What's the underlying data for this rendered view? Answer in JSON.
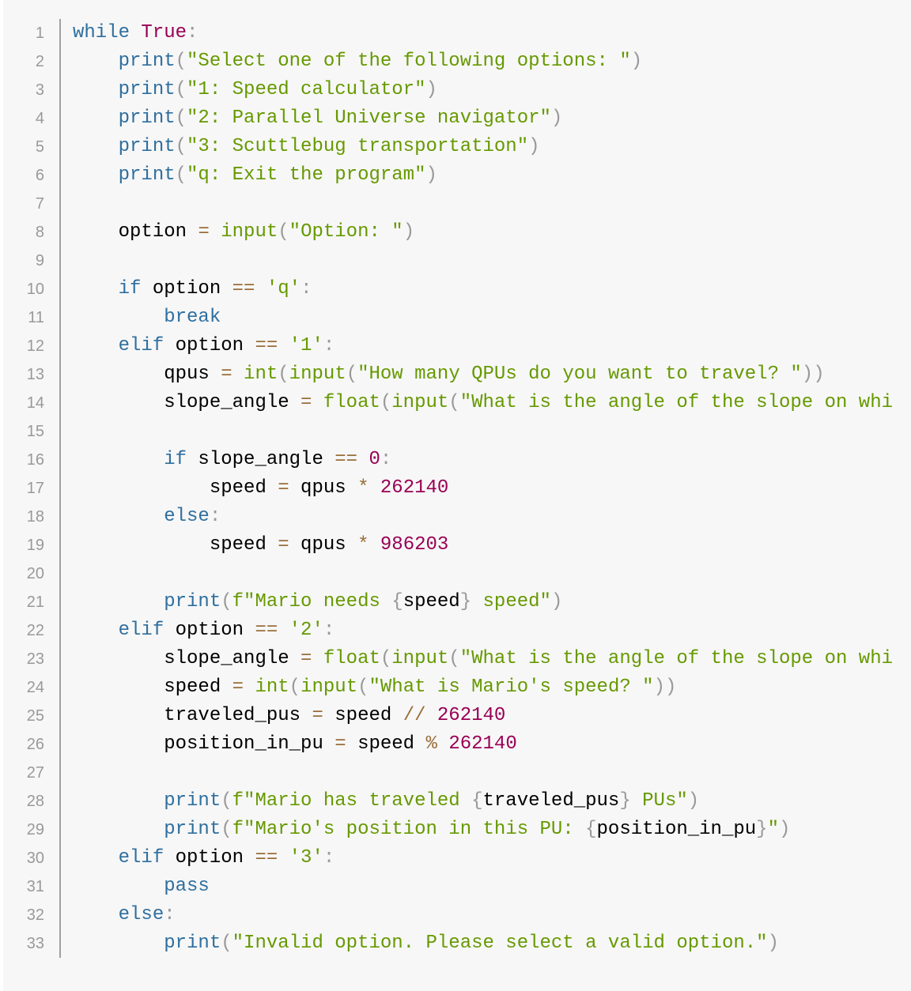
{
  "colors": {
    "background": "#f7f7f7",
    "line_number": "#999999",
    "keyword": "#2f6f9f",
    "boolean_number": "#990055",
    "string": "#669900",
    "operator": "#9a6e3a",
    "punctuation": "#999999",
    "text": "#000000"
  },
  "language": "python",
  "lines": [
    {
      "n": "1",
      "tokens": [
        [
          "kw",
          "while"
        ],
        [
          "var",
          " "
        ],
        [
          "bool",
          "True"
        ],
        [
          "pn",
          ":"
        ]
      ]
    },
    {
      "n": "2",
      "tokens": [
        [
          "var",
          "    "
        ],
        [
          "kw",
          "print"
        ],
        [
          "pn",
          "("
        ],
        [
          "str",
          "\"Select one of the following options: \""
        ],
        [
          "pn",
          ")"
        ]
      ]
    },
    {
      "n": "3",
      "tokens": [
        [
          "var",
          "    "
        ],
        [
          "kw",
          "print"
        ],
        [
          "pn",
          "("
        ],
        [
          "str",
          "\"1: Speed calculator\""
        ],
        [
          "pn",
          ")"
        ]
      ]
    },
    {
      "n": "4",
      "tokens": [
        [
          "var",
          "    "
        ],
        [
          "kw",
          "print"
        ],
        [
          "pn",
          "("
        ],
        [
          "str",
          "\"2: Parallel Universe navigator\""
        ],
        [
          "pn",
          ")"
        ]
      ]
    },
    {
      "n": "5",
      "tokens": [
        [
          "var",
          "    "
        ],
        [
          "kw",
          "print"
        ],
        [
          "pn",
          "("
        ],
        [
          "str",
          "\"3: Scuttlebug transportation\""
        ],
        [
          "pn",
          ")"
        ]
      ]
    },
    {
      "n": "6",
      "tokens": [
        [
          "var",
          "    "
        ],
        [
          "kw",
          "print"
        ],
        [
          "pn",
          "("
        ],
        [
          "str",
          "\"q: Exit the program\""
        ],
        [
          "pn",
          ")"
        ]
      ]
    },
    {
      "n": "7",
      "tokens": []
    },
    {
      "n": "8",
      "tokens": [
        [
          "var",
          "    option "
        ],
        [
          "op",
          "="
        ],
        [
          "var",
          " "
        ],
        [
          "fn",
          "input"
        ],
        [
          "pn",
          "("
        ],
        [
          "str",
          "\"Option: \""
        ],
        [
          "pn",
          ")"
        ]
      ]
    },
    {
      "n": "9",
      "tokens": []
    },
    {
      "n": "10",
      "tokens": [
        [
          "var",
          "    "
        ],
        [
          "kw",
          "if"
        ],
        [
          "var",
          " option "
        ],
        [
          "op",
          "=="
        ],
        [
          "var",
          " "
        ],
        [
          "str",
          "'q'"
        ],
        [
          "pn",
          ":"
        ]
      ]
    },
    {
      "n": "11",
      "tokens": [
        [
          "var",
          "        "
        ],
        [
          "kw",
          "break"
        ]
      ]
    },
    {
      "n": "12",
      "tokens": [
        [
          "var",
          "    "
        ],
        [
          "kw",
          "elif"
        ],
        [
          "var",
          " option "
        ],
        [
          "op",
          "=="
        ],
        [
          "var",
          " "
        ],
        [
          "str",
          "'1'"
        ],
        [
          "pn",
          ":"
        ]
      ]
    },
    {
      "n": "13",
      "tokens": [
        [
          "var",
          "        qpus "
        ],
        [
          "op",
          "="
        ],
        [
          "var",
          " "
        ],
        [
          "fn",
          "int"
        ],
        [
          "pn",
          "("
        ],
        [
          "fn",
          "input"
        ],
        [
          "pn",
          "("
        ],
        [
          "str",
          "\"How many QPUs do you want to travel? \""
        ],
        [
          "pn",
          "))"
        ]
      ]
    },
    {
      "n": "14",
      "tokens": [
        [
          "var",
          "        slope_angle "
        ],
        [
          "op",
          "="
        ],
        [
          "var",
          " "
        ],
        [
          "fn",
          "float"
        ],
        [
          "pn",
          "("
        ],
        [
          "fn",
          "input"
        ],
        [
          "pn",
          "("
        ],
        [
          "str",
          "\"What is the angle of the slope on whi"
        ]
      ]
    },
    {
      "n": "15",
      "tokens": []
    },
    {
      "n": "16",
      "tokens": [
        [
          "var",
          "        "
        ],
        [
          "kw",
          "if"
        ],
        [
          "var",
          " slope_angle "
        ],
        [
          "op",
          "=="
        ],
        [
          "var",
          " "
        ],
        [
          "num",
          "0"
        ],
        [
          "pn",
          ":"
        ]
      ]
    },
    {
      "n": "17",
      "tokens": [
        [
          "var",
          "            speed "
        ],
        [
          "op",
          "="
        ],
        [
          "var",
          " qpus "
        ],
        [
          "op",
          "*"
        ],
        [
          "var",
          " "
        ],
        [
          "num",
          "262140"
        ]
      ]
    },
    {
      "n": "18",
      "tokens": [
        [
          "var",
          "        "
        ],
        [
          "kw",
          "else"
        ],
        [
          "pn",
          ":"
        ]
      ]
    },
    {
      "n": "19",
      "tokens": [
        [
          "var",
          "            speed "
        ],
        [
          "op",
          "="
        ],
        [
          "var",
          " qpus "
        ],
        [
          "op",
          "*"
        ],
        [
          "var",
          " "
        ],
        [
          "num",
          "986203"
        ]
      ]
    },
    {
      "n": "20",
      "tokens": []
    },
    {
      "n": "21",
      "tokens": [
        [
          "var",
          "        "
        ],
        [
          "kw",
          "print"
        ],
        [
          "pn",
          "("
        ],
        [
          "str",
          "f\"Mario needs "
        ],
        [
          "pn",
          "{"
        ],
        [
          "var",
          "speed"
        ],
        [
          "pn",
          "}"
        ],
        [
          "str",
          " speed\""
        ],
        [
          "pn",
          ")"
        ]
      ]
    },
    {
      "n": "22",
      "tokens": [
        [
          "var",
          "    "
        ],
        [
          "kw",
          "elif"
        ],
        [
          "var",
          " option "
        ],
        [
          "op",
          "=="
        ],
        [
          "var",
          " "
        ],
        [
          "str",
          "'2'"
        ],
        [
          "pn",
          ":"
        ]
      ]
    },
    {
      "n": "23",
      "tokens": [
        [
          "var",
          "        slope_angle "
        ],
        [
          "op",
          "="
        ],
        [
          "var",
          " "
        ],
        [
          "fn",
          "float"
        ],
        [
          "pn",
          "("
        ],
        [
          "fn",
          "input"
        ],
        [
          "pn",
          "("
        ],
        [
          "str",
          "\"What is the angle of the slope on whi"
        ]
      ]
    },
    {
      "n": "24",
      "tokens": [
        [
          "var",
          "        speed "
        ],
        [
          "op",
          "="
        ],
        [
          "var",
          " "
        ],
        [
          "fn",
          "int"
        ],
        [
          "pn",
          "("
        ],
        [
          "fn",
          "input"
        ],
        [
          "pn",
          "("
        ],
        [
          "str",
          "\"What is Mario's speed? \""
        ],
        [
          "pn",
          "))"
        ]
      ]
    },
    {
      "n": "25",
      "tokens": [
        [
          "var",
          "        traveled_pus "
        ],
        [
          "op",
          "="
        ],
        [
          "var",
          " speed "
        ],
        [
          "op",
          "//"
        ],
        [
          "var",
          " "
        ],
        [
          "num",
          "262140"
        ]
      ]
    },
    {
      "n": "26",
      "tokens": [
        [
          "var",
          "        position_in_pu "
        ],
        [
          "op",
          "="
        ],
        [
          "var",
          " speed "
        ],
        [
          "op",
          "%"
        ],
        [
          "var",
          " "
        ],
        [
          "num",
          "262140"
        ]
      ]
    },
    {
      "n": "27",
      "tokens": []
    },
    {
      "n": "28",
      "tokens": [
        [
          "var",
          "        "
        ],
        [
          "kw",
          "print"
        ],
        [
          "pn",
          "("
        ],
        [
          "str",
          "f\"Mario has traveled "
        ],
        [
          "pn",
          "{"
        ],
        [
          "var",
          "traveled_pus"
        ],
        [
          "pn",
          "}"
        ],
        [
          "str",
          " PUs\""
        ],
        [
          "pn",
          ")"
        ]
      ]
    },
    {
      "n": "29",
      "tokens": [
        [
          "var",
          "        "
        ],
        [
          "kw",
          "print"
        ],
        [
          "pn",
          "("
        ],
        [
          "str",
          "f\"Mario's position in this PU: "
        ],
        [
          "pn",
          "{"
        ],
        [
          "var",
          "position_in_pu"
        ],
        [
          "pn",
          "}"
        ],
        [
          "str",
          "\""
        ],
        [
          "pn",
          ")"
        ]
      ]
    },
    {
      "n": "30",
      "tokens": [
        [
          "var",
          "    "
        ],
        [
          "kw",
          "elif"
        ],
        [
          "var",
          " option "
        ],
        [
          "op",
          "=="
        ],
        [
          "var",
          " "
        ],
        [
          "str",
          "'3'"
        ],
        [
          "pn",
          ":"
        ]
      ]
    },
    {
      "n": "31",
      "tokens": [
        [
          "var",
          "        "
        ],
        [
          "kw",
          "pass"
        ]
      ]
    },
    {
      "n": "32",
      "tokens": [
        [
          "var",
          "    "
        ],
        [
          "kw",
          "else"
        ],
        [
          "pn",
          ":"
        ]
      ]
    },
    {
      "n": "33",
      "tokens": [
        [
          "var",
          "        "
        ],
        [
          "kw",
          "print"
        ],
        [
          "pn",
          "("
        ],
        [
          "str",
          "\"Invalid option. Please select a valid option.\""
        ],
        [
          "pn",
          ")"
        ]
      ]
    }
  ]
}
